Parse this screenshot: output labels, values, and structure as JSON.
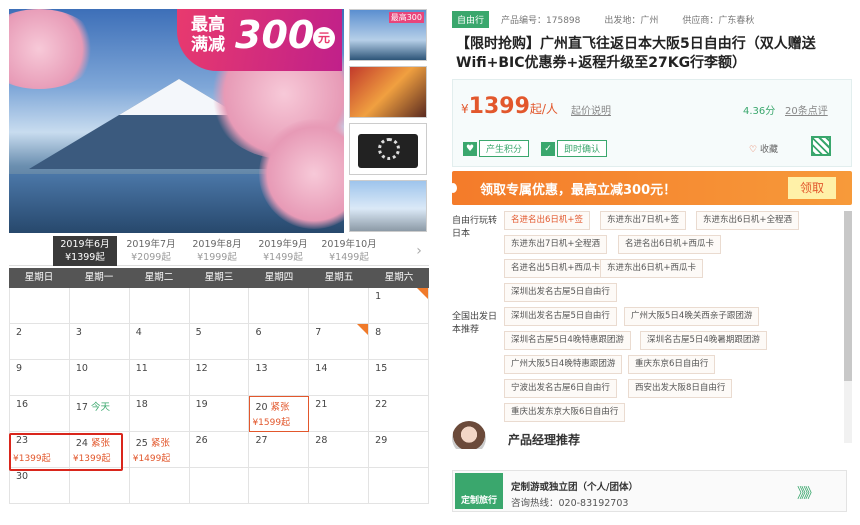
{
  "gallery": {
    "promo_line1": "最高满减",
    "promo_amount": "300",
    "promo_unit": "元",
    "thumb_badge": "最高300"
  },
  "months": [
    {
      "label": "2019年6月",
      "price": "¥1399起"
    },
    {
      "label": "2019年7月",
      "price": "¥2099起"
    },
    {
      "label": "2019年8月",
      "price": "¥1999起"
    },
    {
      "label": "2019年9月",
      "price": "¥1499起"
    },
    {
      "label": "2019年10月",
      "price": "¥1499起"
    }
  ],
  "weekdays": [
    "星期日",
    "星期一",
    "星期二",
    "星期三",
    "星期四",
    "星期五",
    "星期六"
  ],
  "calendar": {
    "d1": "1",
    "d2": "2",
    "d3": "3",
    "d4": "4",
    "d5": "5",
    "d6": "6",
    "d7": "7",
    "d8": "8",
    "d9": "9",
    "d10": "10",
    "d11": "11",
    "d12": "12",
    "d13": "13",
    "d14": "14",
    "d15": "15",
    "d16": "16",
    "d17": "17",
    "d18": "18",
    "d19": "19",
    "d20": "20",
    "d21": "21",
    "d22": "22",
    "d23": "23",
    "d24": "24",
    "d25": "25",
    "d26": "26",
    "d27": "27",
    "d28": "28",
    "d29": "29",
    "d30": "30",
    "today": "今天",
    "tight": "紧张",
    "p20": "¥1599起",
    "p23": "¥1399起",
    "p24": "¥1399起",
    "p25": "¥1499起"
  },
  "product": {
    "type_badge": "自由行",
    "code": "产品编号：175898",
    "origin": "出发地：广州",
    "supplier": "供应商：广东春秋",
    "title": "【限时抢购】广州直飞往返日本大阪5日自由行（双人赠送Wifi+BIC优惠券+返程升级至27KG行李额）",
    "currency": "¥",
    "price": "1399",
    "price_unit": "起/人",
    "price_explain": "起价说明",
    "score": "4.36分",
    "reviews": "20条点评",
    "points": "产生积分",
    "instant": "即时确认",
    "favorite": "收藏"
  },
  "banner": {
    "text": "领取专属优惠，最高立减300元！",
    "button": "领取"
  },
  "play": {
    "label": "自由行玩转日本",
    "items": [
      "名进名出6日机+签",
      "东进东出7日机+签",
      "东进东出6日机+全程酒",
      "东进东出7日机+全程酒",
      "名进名出6日机+西瓜卡",
      "名进名出5日机+西瓜卡",
      "东进东出6日机+西瓜卡",
      "深圳出发名古屋5日自由行"
    ]
  },
  "recommend": {
    "label": "全国出发日本推荐",
    "items": [
      "深圳出发名古屋5日自由行",
      "广州大阪5日4晚关西亲子跟团游",
      "深圳名古屋5日4晚特惠跟团游",
      "深圳名古屋5日4晚暑期跟团游",
      "广州大阪5日4晚特惠跟团游",
      "重庆东京6日自由行",
      "宁波出发名古屋6日自由行",
      "西安出发大阪8日自由行",
      "重庆出发东京大阪6日自由行"
    ]
  },
  "manager": {
    "title": "产品经理推荐"
  },
  "custom": {
    "logo": "定制旅行",
    "title": "定制游或独立团（个人/团体）",
    "hotline": "咨询热线：020-83192703",
    "arrows": "》》》"
  }
}
